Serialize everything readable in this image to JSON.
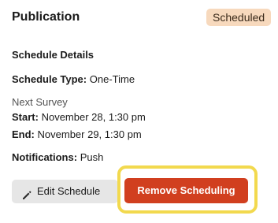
{
  "header": {
    "title": "Publication",
    "status_badge": "Scheduled"
  },
  "details": {
    "heading": "Schedule Details",
    "schedule_type_label": "Schedule Type:",
    "schedule_type_value": "One-Time",
    "next_survey_label": "Next Survey",
    "start_label": "Start:",
    "start_value": "November 28, 1:30 pm",
    "end_label": "End:",
    "end_value": "November 29, 1:30 pm",
    "notifications_label": "Notifications:",
    "notifications_value": "Push"
  },
  "actions": {
    "edit_label": "Edit Schedule",
    "edit_icon": "pencil-icon",
    "remove_label": "Remove Scheduling"
  },
  "colors": {
    "badge_bg": "#f7d9bd",
    "remove_bg": "#d13f1f",
    "edit_bg": "#e6e6e6",
    "highlight": "#f2d94e"
  }
}
